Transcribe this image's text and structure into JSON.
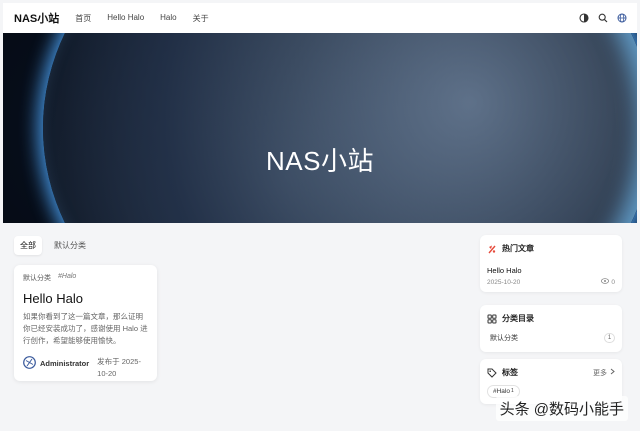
{
  "header": {
    "brand": "NAS小站",
    "nav": [
      "首页",
      "Hello Halo",
      "Halo",
      "关于"
    ]
  },
  "hero": {
    "title": "NAS小站"
  },
  "tabs": [
    {
      "label": "全部",
      "active": true
    },
    {
      "label": "默认分类",
      "active": false
    }
  ],
  "post": {
    "category": "默认分类",
    "tag": "#Halo",
    "title": "Hello Halo",
    "excerpt": "如果你看到了这一篇文章，那么证明你已经安装成功了，感谢使用 Halo 进行创作，希望能够使用愉快。",
    "author": "Administrator",
    "published": "发布于 2025-10-20"
  },
  "sidebar": {
    "hot": {
      "heading": "热门文章",
      "post_title": "Hello Halo",
      "date": "2025-10-20",
      "views": "0"
    },
    "categories": {
      "heading": "分类目录",
      "items": [
        {
          "name": "默认分类",
          "count": "1"
        }
      ]
    },
    "tags": {
      "heading": "标签",
      "more": "更多",
      "items": [
        {
          "name": "#Halo",
          "count": "1"
        }
      ]
    }
  },
  "watermark": "头条 @数码小能手",
  "colors": {
    "accent_hot": "#e64a3b",
    "accent_avatar": "#3a5a9c",
    "header_bg": "#ffffff",
    "page_bg": "#f4f5f7"
  },
  "icons": [
    "theme-toggle-icon",
    "search-icon",
    "globe-icon",
    "flame-icon",
    "grid-icon",
    "tag-icon",
    "eye-icon",
    "chevron-right-icon"
  ]
}
